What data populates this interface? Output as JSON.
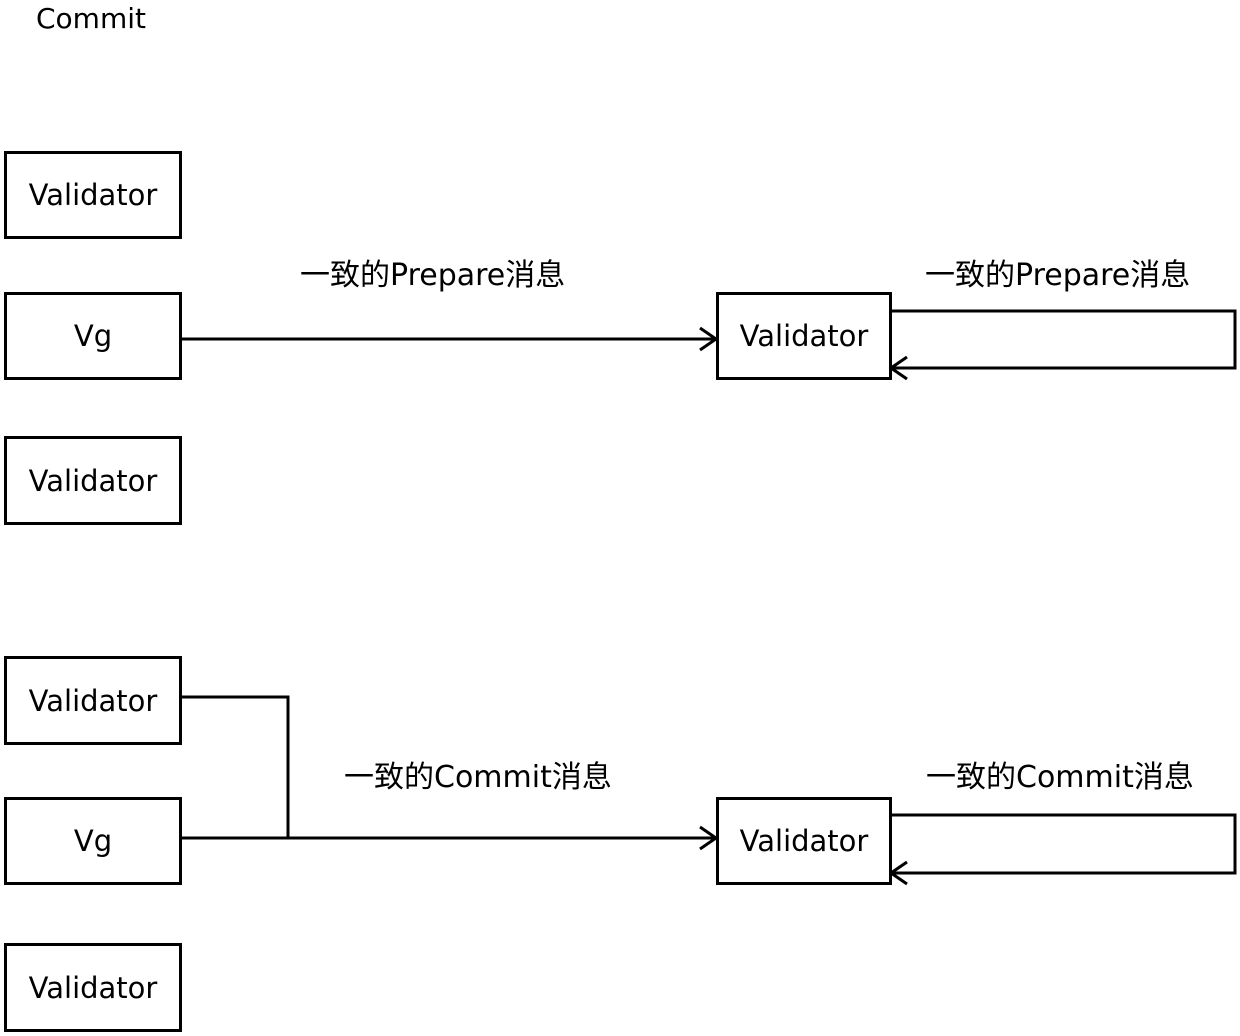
{
  "title": "Commit",
  "prepare_phase": {
    "left_nodes": [
      "Validator",
      "Vg",
      "Validator"
    ],
    "target_node": "Validator",
    "edge_label": "一致的Prepare消息",
    "self_loop_label": "一致的Prepare消息"
  },
  "commit_phase": {
    "left_nodes": [
      "Validator",
      "Vg",
      "Validator"
    ],
    "target_node": "Validator",
    "edge_label": "一致的Commit消息",
    "self_loop_label": "一致的Commit消息"
  }
}
